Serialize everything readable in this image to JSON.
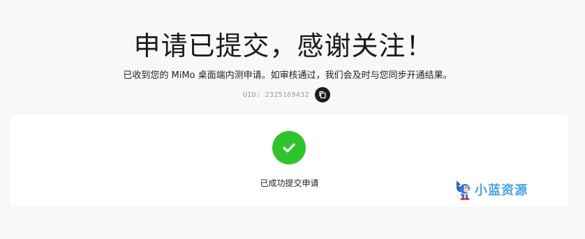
{
  "header": {
    "title": "申请已提交，感谢关注！",
    "subtitle": "已收到您的 MiMo 桌面端内测申请。如审核通过，我们会及时与您同步开通结果。",
    "uid_text": "UID: 2325169432"
  },
  "card": {
    "success_text": "已成功提交申请"
  },
  "watermark": {
    "text": "小蓝资源"
  },
  "icons": {
    "copy": "copy-icon",
    "check": "checkmark-icon",
    "mascot": "hedgehog-mascot-icon"
  },
  "colors": {
    "background": "#f9f8f7",
    "card": "#ffffff",
    "success": "#2fc42d",
    "copy_button": "#1c1c1c",
    "watermark": "#4aa3e8"
  }
}
